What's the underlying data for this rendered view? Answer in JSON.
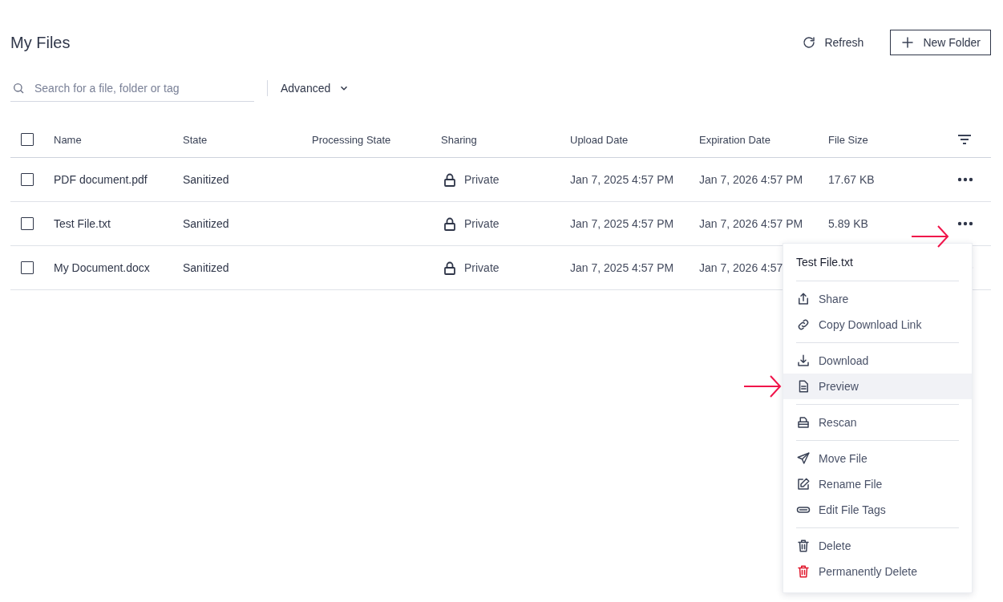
{
  "page": {
    "title": "My Files"
  },
  "header_actions": [
    {
      "kind": "refresh",
      "label": "Refresh"
    },
    {
      "kind": "new-folder",
      "label": "New Folder"
    }
  ],
  "search": {
    "placeholder": "Search for a file, folder or tag"
  },
  "advanced": {
    "label": "Advanced",
    "expanded": false
  },
  "table": {
    "select_all": {
      "checked": false
    },
    "columns": [
      "Name",
      "State",
      "Processing State",
      "Sharing",
      "Upload Date",
      "Expiration Date",
      "File Size"
    ],
    "rows": [
      {
        "checked": false,
        "name": "PDF document.pdf",
        "state": "Sanitized",
        "sharing": "Private",
        "upload_date": "Jan 7, 2025 4:57 PM",
        "expiration_date": "Jan 7, 2026 4:57 PM",
        "file_size": "17.67 KB"
      },
      {
        "checked": false,
        "name": "Test File.txt",
        "state": "Sanitized",
        "sharing": "Private",
        "upload_date": "Jan 7, 2025 4:57 PM",
        "expiration_date": "Jan 7, 2026 4:57 PM",
        "file_size": "5.89 KB"
      },
      {
        "checked": false,
        "name": "My Document.docx",
        "state": "Sanitized",
        "sharing": "Private",
        "upload_date": "Jan 7, 2025 4:57 PM",
        "expiration_date": "Jan 7, 2026 4:57",
        "file_size": ""
      }
    ]
  },
  "context_menu": {
    "title": "Test File.txt",
    "groups": [
      [
        {
          "kind": "share",
          "label": "Share",
          "selected": false
        },
        {
          "kind": "link",
          "label": "Copy Download Link",
          "selected": false
        }
      ],
      [
        {
          "kind": "download",
          "label": "Download",
          "selected": false
        },
        {
          "kind": "preview",
          "label": "Preview",
          "selected": true
        }
      ],
      [
        {
          "kind": "rescan",
          "label": "Rescan",
          "selected": false
        }
      ],
      [
        {
          "kind": "move",
          "label": "Move File",
          "selected": false
        },
        {
          "kind": "rename",
          "label": "Rename File",
          "selected": false
        },
        {
          "kind": "tags",
          "label": "Edit File Tags",
          "selected": false
        }
      ],
      [
        {
          "kind": "delete",
          "label": "Delete",
          "selected": false
        },
        {
          "kind": "permanent-delete",
          "label": "Permanently Delete",
          "selected": false
        }
      ]
    ]
  }
}
